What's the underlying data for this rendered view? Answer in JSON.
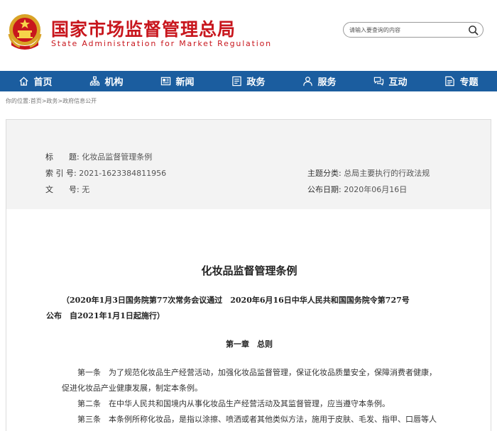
{
  "header": {
    "title": "国家市场监督管理总局",
    "subtitle": "State Administration for Market Regulation",
    "search_placeholder": "请输入要查询的内容",
    "brand_color": "#c8161d"
  },
  "nav": {
    "color": "#1b5d9f",
    "items": [
      {
        "label": "首页",
        "icon": "home-icon"
      },
      {
        "label": "机构",
        "icon": "org-chart-icon"
      },
      {
        "label": "新闻",
        "icon": "news-icon"
      },
      {
        "label": "政务",
        "icon": "government-icon"
      },
      {
        "label": "服务",
        "icon": "service-icon"
      },
      {
        "label": "互动",
        "icon": "interaction-icon"
      },
      {
        "label": "专题",
        "icon": "topic-icon"
      }
    ]
  },
  "breadcrumb": "你的位置:首页>政务>政府信息公开",
  "info": {
    "title_label": "标　　题:",
    "title_value": "化妆品监督管理条例",
    "index_label": "索 引 号:",
    "index_value": "2021-1623384811956",
    "docno_label": "文　　号:",
    "docno_value": "无",
    "category_label": "主题分类:",
    "category_value": "总局主要执行的行政法规",
    "date_label": "公布日期:",
    "date_value": "2020年06月16日"
  },
  "doc": {
    "title": "化妆品监督管理条例",
    "meta_line1": "（2020年1月3日国务院第77次常务会议通过　2020年6月16日中华人民共和国国务院令第727号",
    "meta_line2": "公布　自2021年1月1日起施行）",
    "chapter": "第一章　总则",
    "para1_line1": "第一条　为了规范化妆品生产经营活动，加强化妆品监督管理，保证化妆品质量安全，保障消费者健康，",
    "para1_line2": "促进化妆品产业健康发展，制定本条例。",
    "para2": "第二条　在中华人民共和国境内从事化妆品生产经营活动及其监督管理，应当遵守本条例。",
    "para3": "第三条　本条例所称化妆品，是指以涂擦、喷洒或者其他类似方法，施用于皮肤、毛发、指甲、口唇等人"
  }
}
